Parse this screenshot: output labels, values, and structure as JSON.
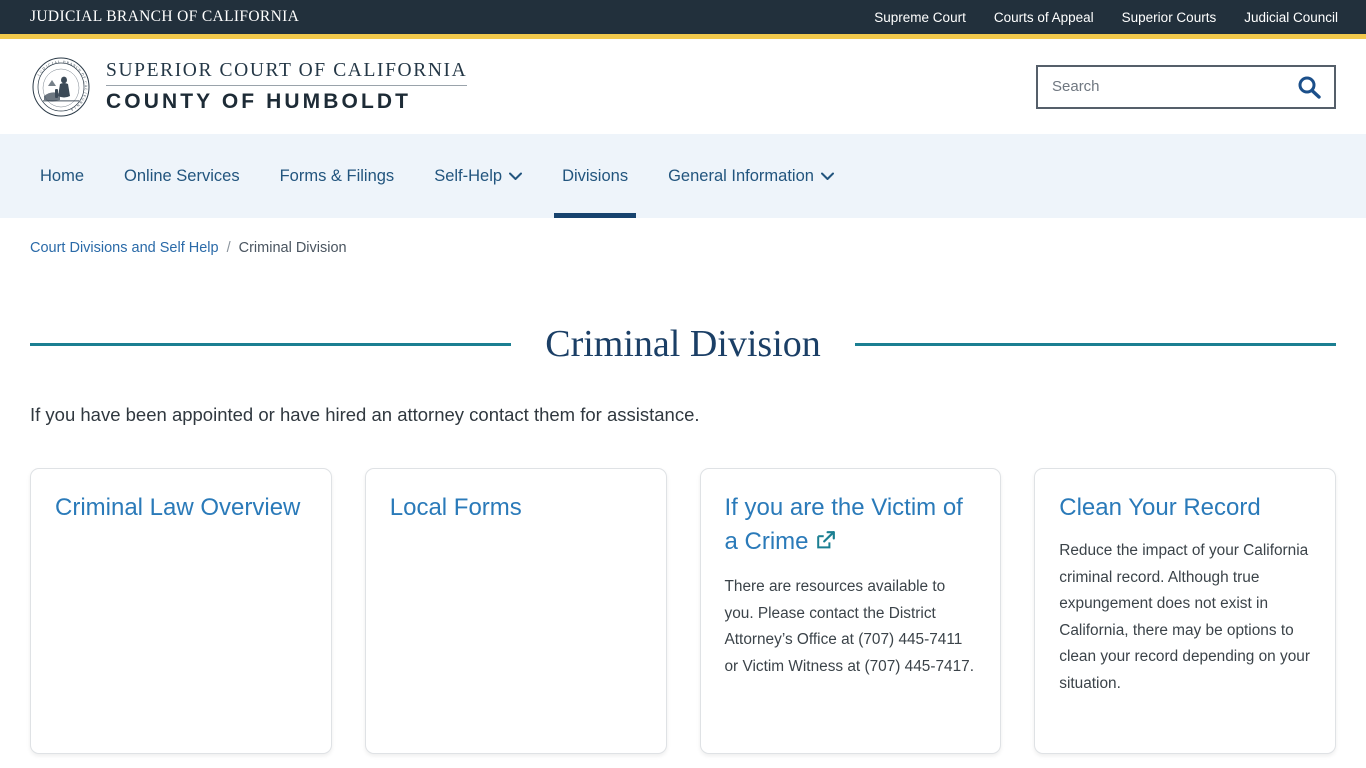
{
  "topbar": {
    "brand": "JUDICIAL BRANCH OF CALIFORNIA",
    "links": [
      {
        "label": "Supreme Court"
      },
      {
        "label": "Courts of Appeal"
      },
      {
        "label": "Superior Courts"
      },
      {
        "label": "Judicial Council"
      }
    ]
  },
  "masthead": {
    "seal_alt": "judicial-branch-seal",
    "wordmark_line1": "SUPERIOR COURT OF CALIFORNIA",
    "wordmark_line2": "COUNTY OF HUMBOLDT",
    "search": {
      "placeholder": "Search",
      "value": "",
      "icon": "search-icon"
    }
  },
  "nav": {
    "items": [
      {
        "label": "Home",
        "has_dropdown": false,
        "active": false
      },
      {
        "label": "Online Services",
        "has_dropdown": false,
        "active": false
      },
      {
        "label": "Forms & Filings",
        "has_dropdown": false,
        "active": false
      },
      {
        "label": "Self-Help",
        "has_dropdown": true,
        "active": false
      },
      {
        "label": "Divisions",
        "has_dropdown": false,
        "active": true
      },
      {
        "label": "General Information",
        "has_dropdown": true,
        "active": false
      }
    ]
  },
  "breadcrumb": {
    "parent": "Court Divisions and Self Help",
    "separator": "/",
    "current": "Criminal Division"
  },
  "page": {
    "title": "Criminal Division",
    "intro": "If you have been appointed or have hired an attorney contact them for assistance."
  },
  "cards": [
    {
      "title": "Criminal Law Overview",
      "body": "",
      "external": false
    },
    {
      "title": "Local Forms",
      "body": "",
      "external": false
    },
    {
      "title": "If you are the Victim of a Crime",
      "body": "There are resources available to you. Please contact the District Attorney’s Office at (707) 445-7411 or Victim Witness at (707) 445-7417.",
      "external": true,
      "external_icon": "external-link-icon"
    },
    {
      "title": "Clean Your Record",
      "body": "Reduce the impact of your California criminal record. Although true expungement does not exist in California, there may be options to clean your record depending on your situation.",
      "external": false
    }
  ],
  "colors": {
    "topbar_bg": "#22303c",
    "gold_accent": "#f2c94c",
    "nav_bg": "#eef4fa",
    "nav_link": "#22557e",
    "active_underline": "#17436e",
    "title_navy": "#1b3f66",
    "rule_teal": "#1b7f92",
    "card_link_blue": "#2a7ab9",
    "search_icon_blue": "#1b4f8a"
  }
}
